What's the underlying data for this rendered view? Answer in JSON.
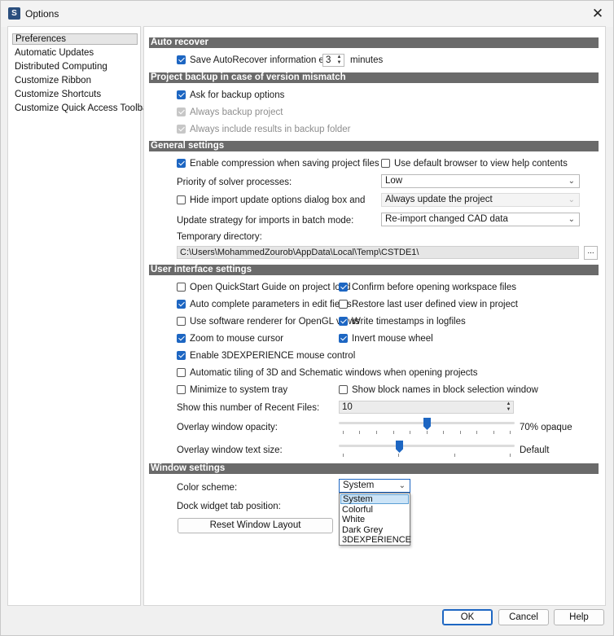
{
  "window": {
    "title": "Options",
    "app_icon": "S",
    "close": "✕"
  },
  "nav": {
    "items": [
      {
        "label": "Preferences",
        "selected": true
      },
      {
        "label": "Automatic Updates"
      },
      {
        "label": "Distributed Computing"
      },
      {
        "label": "Customize Ribbon"
      },
      {
        "label": "Customize Shortcuts"
      },
      {
        "label": "Customize Quick Access Toolbar"
      }
    ]
  },
  "sections": {
    "auto_recover": "Auto recover",
    "project_backup": "Project backup in case of version mismatch",
    "general": "General settings",
    "ui": "User interface settings",
    "window": "Window settings"
  },
  "auto_recover": {
    "save_label": "Save AutoRecover information every",
    "save_checked": true,
    "interval": "3",
    "unit": "minutes"
  },
  "project_backup": {
    "ask": {
      "label": "Ask for backup options",
      "checked": true
    },
    "always_backup": {
      "label": "Always backup project",
      "checked": true,
      "disabled": true
    },
    "include_results": {
      "label": "Always include results in backup folder",
      "checked": true,
      "disabled": true
    }
  },
  "general": {
    "compression": {
      "label": "Enable compression when saving project files",
      "checked": true
    },
    "default_browser": {
      "label": "Use default browser to view help contents",
      "checked": false
    },
    "priority_label": "Priority of solver processes:",
    "priority_value": "Low",
    "hide_import": {
      "label": "Hide import update options dialog box and",
      "checked": false
    },
    "hide_import_value": "Always update the project",
    "update_strategy_label": "Update strategy for imports in batch mode:",
    "update_strategy_value": "Re-import changed CAD data",
    "temp_dir_label": "Temporary directory:",
    "temp_dir_value": "C:\\Users\\MohammedZourob\\AppData\\Local\\Temp\\CSTDE1\\",
    "browse": "..."
  },
  "ui": {
    "quickstart": {
      "label": "Open QuickStart Guide on project load",
      "checked": false
    },
    "confirm_workspace": {
      "label": "Confirm before opening workspace files",
      "checked": true
    },
    "autocomplete": {
      "label": "Auto complete parameters in edit fields",
      "checked": true
    },
    "restore_view": {
      "label": "Restore last user defined view in project",
      "checked": false
    },
    "software_renderer": {
      "label": "Use software renderer for OpenGL views",
      "checked": false
    },
    "timestamps": {
      "label": "Write timestamps in logfiles",
      "checked": true
    },
    "zoom_mouse": {
      "label": "Zoom to mouse cursor",
      "checked": true
    },
    "invert_wheel": {
      "label": "Invert mouse wheel",
      "checked": true
    },
    "mouse_3dx": {
      "label": "Enable 3DEXPERIENCE mouse control",
      "checked": true
    },
    "auto_tiling": {
      "label": "Automatic tiling of 3D and Schematic windows when opening projects",
      "checked": false
    },
    "minimize_tray": {
      "label": "Minimize to system tray",
      "checked": false
    },
    "block_names": {
      "label": "Show block names in block selection window",
      "checked": false
    },
    "recent_files_label": "Show this number of Recent Files:",
    "recent_files_value": "10",
    "opacity_label": "Overlay window opacity:",
    "opacity_value_text": "70% opaque",
    "opacity_fraction": 0.5,
    "text_size_label": "Overlay window text size:",
    "text_size_value_text": "Default",
    "text_size_fraction": 0.34
  },
  "window_settings": {
    "color_scheme_label": "Color scheme:",
    "color_scheme_value": "System",
    "dock_label": "Dock widget tab position:",
    "reset_button": "Reset Window Layout",
    "color_options": [
      "System",
      "Colorful",
      "White",
      "Dark Grey",
      "3DEXPERIENCE"
    ]
  },
  "footer": {
    "ok": "OK",
    "cancel": "Cancel",
    "help": "Help"
  },
  "colors": {
    "accent": "#1d66c2",
    "section_header": "#6a6a6a"
  }
}
